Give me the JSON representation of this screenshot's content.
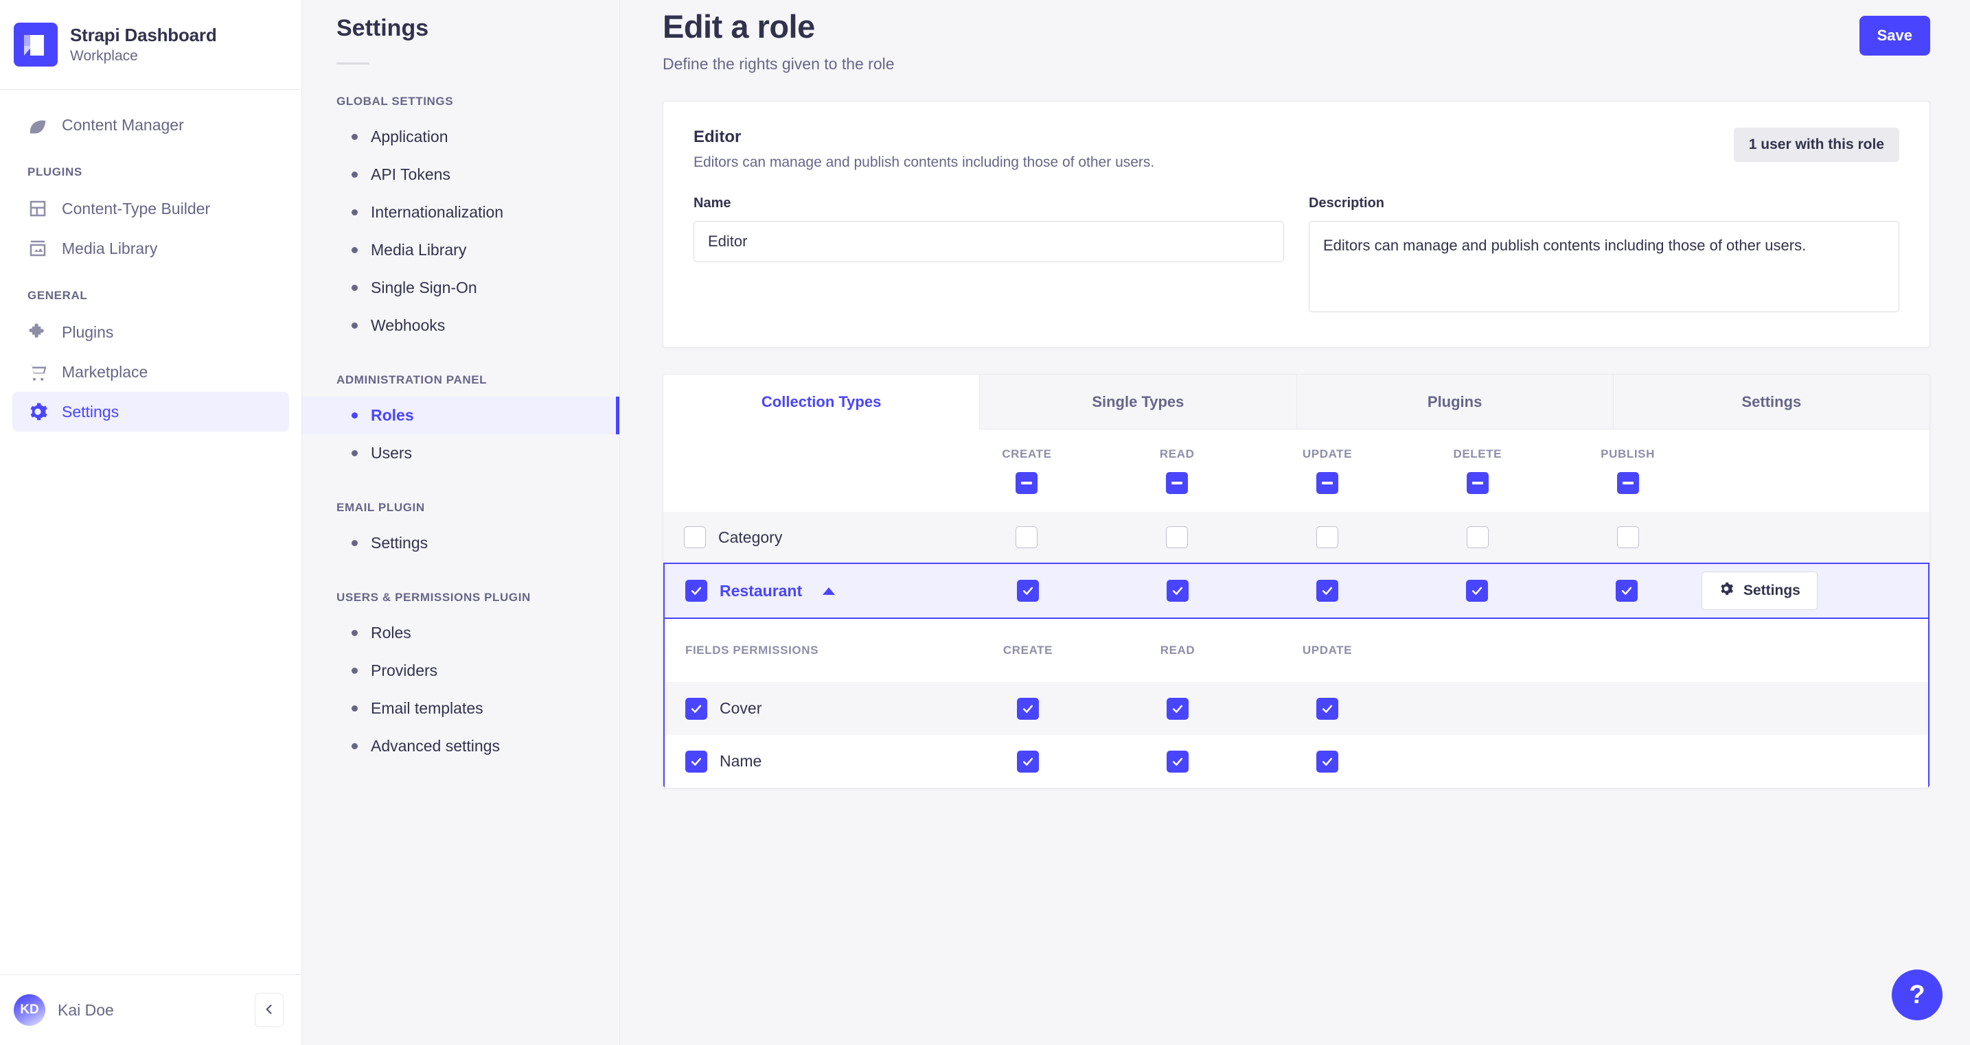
{
  "brand": {
    "title": "Strapi Dashboard",
    "subtitle": "Workplace",
    "logo_color": "#4945ff"
  },
  "sidebar": {
    "top_items": [
      {
        "label": "Content Manager",
        "icon": "feather-icon"
      }
    ],
    "sections": [
      {
        "label": "PLUGINS",
        "items": [
          {
            "label": "Content-Type Builder",
            "icon": "layout-icon"
          },
          {
            "label": "Media Library",
            "icon": "image-icon"
          }
        ]
      },
      {
        "label": "GENERAL",
        "items": [
          {
            "label": "Plugins",
            "icon": "puzzle-icon"
          },
          {
            "label": "Marketplace",
            "icon": "cart-icon"
          },
          {
            "label": "Settings",
            "icon": "gear-icon",
            "active": true
          }
        ]
      }
    ],
    "footer": {
      "avatar_initials": "KD",
      "user_name": "Kai Doe",
      "collapse_icon": "chevron-left-icon"
    }
  },
  "subnav": {
    "title": "Settings",
    "groups": [
      {
        "label": "GLOBAL SETTINGS",
        "items": [
          {
            "label": "Application"
          },
          {
            "label": "API Tokens"
          },
          {
            "label": "Internationalization"
          },
          {
            "label": "Media Library"
          },
          {
            "label": "Single Sign-On"
          },
          {
            "label": "Webhooks"
          }
        ]
      },
      {
        "label": "ADMINISTRATION PANEL",
        "items": [
          {
            "label": "Roles",
            "active": true
          },
          {
            "label": "Users"
          }
        ]
      },
      {
        "label": "EMAIL PLUGIN",
        "items": [
          {
            "label": "Settings"
          }
        ]
      },
      {
        "label": "USERS & PERMISSIONS PLUGIN",
        "items": [
          {
            "label": "Roles"
          },
          {
            "label": "Providers"
          },
          {
            "label": "Email templates"
          },
          {
            "label": "Advanced settings"
          }
        ]
      }
    ]
  },
  "header": {
    "title": "Edit a role",
    "subtitle": "Define the rights given to the role",
    "save_label": "Save"
  },
  "role_card": {
    "name_heading": "Editor",
    "description_text": "Editors can manage and publish contents including those of other users.",
    "user_count_badge": "1 user with this role",
    "name_label": "Name",
    "name_value": "Editor",
    "name_placeholder": "Name",
    "description_label": "Description",
    "description_value": "Editors can manage and publish contents including those of other users.",
    "description_placeholder": "Description"
  },
  "permissions": {
    "tabs": [
      {
        "label": "Collection Types",
        "active": true
      },
      {
        "label": "Single Types",
        "active": false
      },
      {
        "label": "Plugins",
        "active": false
      },
      {
        "label": "Settings",
        "active": false
      }
    ],
    "action_columns": [
      "CREATE",
      "READ",
      "UPDATE",
      "DELETE",
      "PUBLISH"
    ],
    "header_checkbox_states": [
      "indeterminate",
      "indeterminate",
      "indeterminate",
      "indeterminate",
      "indeterminate"
    ],
    "content_types": [
      {
        "name": "Category",
        "selected": false,
        "row_checkbox": "unchecked",
        "actions": [
          "unchecked",
          "unchecked",
          "unchecked",
          "unchecked",
          "unchecked"
        ],
        "expanded": false
      },
      {
        "name": "Restaurant",
        "selected": true,
        "row_checkbox": "checked",
        "actions": [
          "checked",
          "checked",
          "checked",
          "checked",
          "checked"
        ],
        "expanded": true,
        "collapse_icon": "chevron-up-icon",
        "settings_label": "Settings",
        "settings_icon": "gear-icon"
      }
    ],
    "fields_section": {
      "label": "FIELDS PERMISSIONS",
      "columns": [
        "CREATE",
        "READ",
        "UPDATE"
      ],
      "rows": [
        {
          "name": "Cover",
          "checkbox": "checked",
          "actions": [
            "checked",
            "checked",
            "checked"
          ]
        },
        {
          "name": "Name",
          "checkbox": "checked",
          "actions": [
            "checked",
            "checked",
            "checked"
          ]
        }
      ]
    }
  },
  "help": {
    "label": "?"
  },
  "colors": {
    "accent": "#4945ff",
    "accent_light": "#f0f0ff",
    "text": "#32324d",
    "muted": "#666687",
    "border": "#eaeaef",
    "page_bg": "#f6f6f9"
  }
}
